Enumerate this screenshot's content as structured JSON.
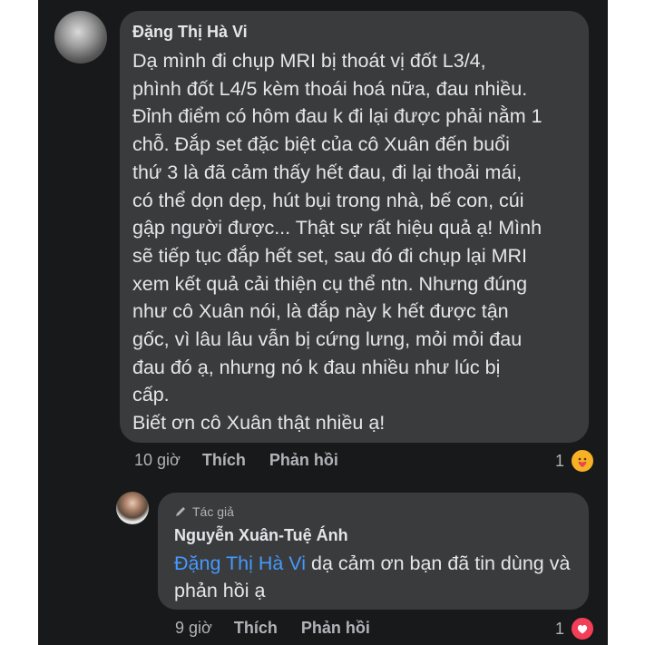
{
  "comment": {
    "author": "Đặng Thị Hà Vi",
    "text": "Dạ mình đi chụp MRI bị thoát vị đốt L3/4,\nphình đốt L4/5 kèm thoái hoá nữa, đau nhiều.\nĐỉnh điểm có hôm đau k đi lại được phải nằm 1\nchỗ. Đắp set đặc biệt của cô Xuân đến buổi\nthứ 3 là đã cảm thấy hết đau, đi lại thoải mái,\ncó thể dọn dẹp, hút bụi trong nhà, bế con, cúi\ngập người được... Thật sự rất hiệu quả ạ! Mình\nsẽ tiếp tục đắp hết set, sau đó đi chụp lại MRI\nxem kết quả cải thiện cụ thể ntn. Nhưng đúng\nnhư cô Xuân nói, là đắp này k hết được tận\ngốc, vì lâu lâu vẫn bị cứng lưng, mỏi mỏi đau\nđau đó ạ, nhưng nó k đau nhiều như lúc bị\ncấp.\nBiết ơn cô Xuân thật nhiều ạ!",
    "time": "10 giờ",
    "like_label": "Thích",
    "reply_label": "Phản hồi",
    "reaction_count": "1",
    "reaction_icon": "care-emoji-icon"
  },
  "reply": {
    "badge": "Tác giả",
    "author": "Nguyễn Xuân-Tuệ Ánh",
    "mention": "Đặng Thị Hà Vi",
    "text": " dạ cảm ơn bạn đã tin dùng và phản hồi ạ",
    "time": "9 giờ",
    "like_label": "Thích",
    "reply_label": "Phản hồi",
    "reaction_count": "1",
    "reaction_icon": "love-heart-icon"
  },
  "colors": {
    "background": "#18191a",
    "bubble": "#3a3b3c",
    "text": "#e4e6eb",
    "secondary": "#b0b3b8",
    "mention": "#4599ff",
    "care": "#f7b125",
    "love": "#f33e58"
  }
}
